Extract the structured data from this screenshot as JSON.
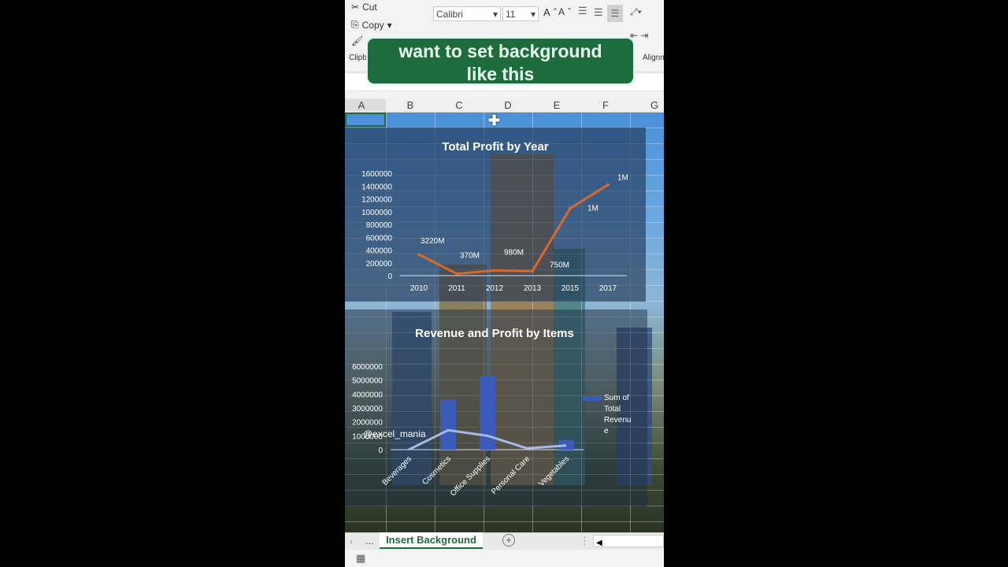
{
  "ribbon": {
    "cut": "Cut",
    "copy": "Copy",
    "clipboard": "Clipb",
    "font": "Calibri",
    "size": "11",
    "alignment": "Alignm",
    "grow": "A",
    "shrink": "A"
  },
  "caption": {
    "line1": "want to set background",
    "line2": "like this"
  },
  "columns": [
    "A",
    "B",
    "C",
    "D",
    "E",
    "F",
    "G"
  ],
  "watermark": "@excel_mania",
  "sheet_tab": "Insert Background",
  "more_tabs": "...",
  "colors": {
    "accent": "#1e6b3e",
    "profit_line": "#d9682b",
    "revenue_bar": "#3a5cb8",
    "profit_line2": "#a9b8e6"
  },
  "chart_data": [
    {
      "type": "line",
      "title": "Total Profit by Year",
      "categories": [
        "2010",
        "2011",
        "2012",
        "2013",
        "2015",
        "2017"
      ],
      "values": [
        330000,
        30000,
        80000,
        70000,
        1050000,
        1420000
      ],
      "data_labels": [
        "3220M",
        "370M",
        "980M",
        "750M",
        "1M",
        "1M"
      ],
      "yticks": [
        "0",
        "200000",
        "400000",
        "600000",
        "800000",
        "1000000",
        "1200000",
        "1400000",
        "1600000"
      ],
      "ylim": [
        0,
        1600000
      ],
      "grid": true
    },
    {
      "type": "bar",
      "title": "Revenue and Profit by Items",
      "categories": [
        "Beverages",
        "Cosmetics",
        "Office Supplies",
        "Personal Care",
        "Vegetables"
      ],
      "series": [
        {
          "name": "Sum of Total Revenue",
          "type": "bar",
          "values": [
            0,
            3600000,
            5300000,
            0,
            700000
          ]
        },
        {
          "type": "line",
          "values": [
            0,
            1400000,
            1000000,
            100000,
            300000
          ]
        }
      ],
      "legend_lines": [
        "Sum of",
        "Total",
        "Revenu",
        "e"
      ],
      "yticks": [
        "0",
        "1000000",
        "2000000",
        "3000000",
        "4000000",
        "5000000",
        "6000000"
      ],
      "ylim": [
        0,
        6000000
      ],
      "legend": "right",
      "grid": true
    }
  ]
}
